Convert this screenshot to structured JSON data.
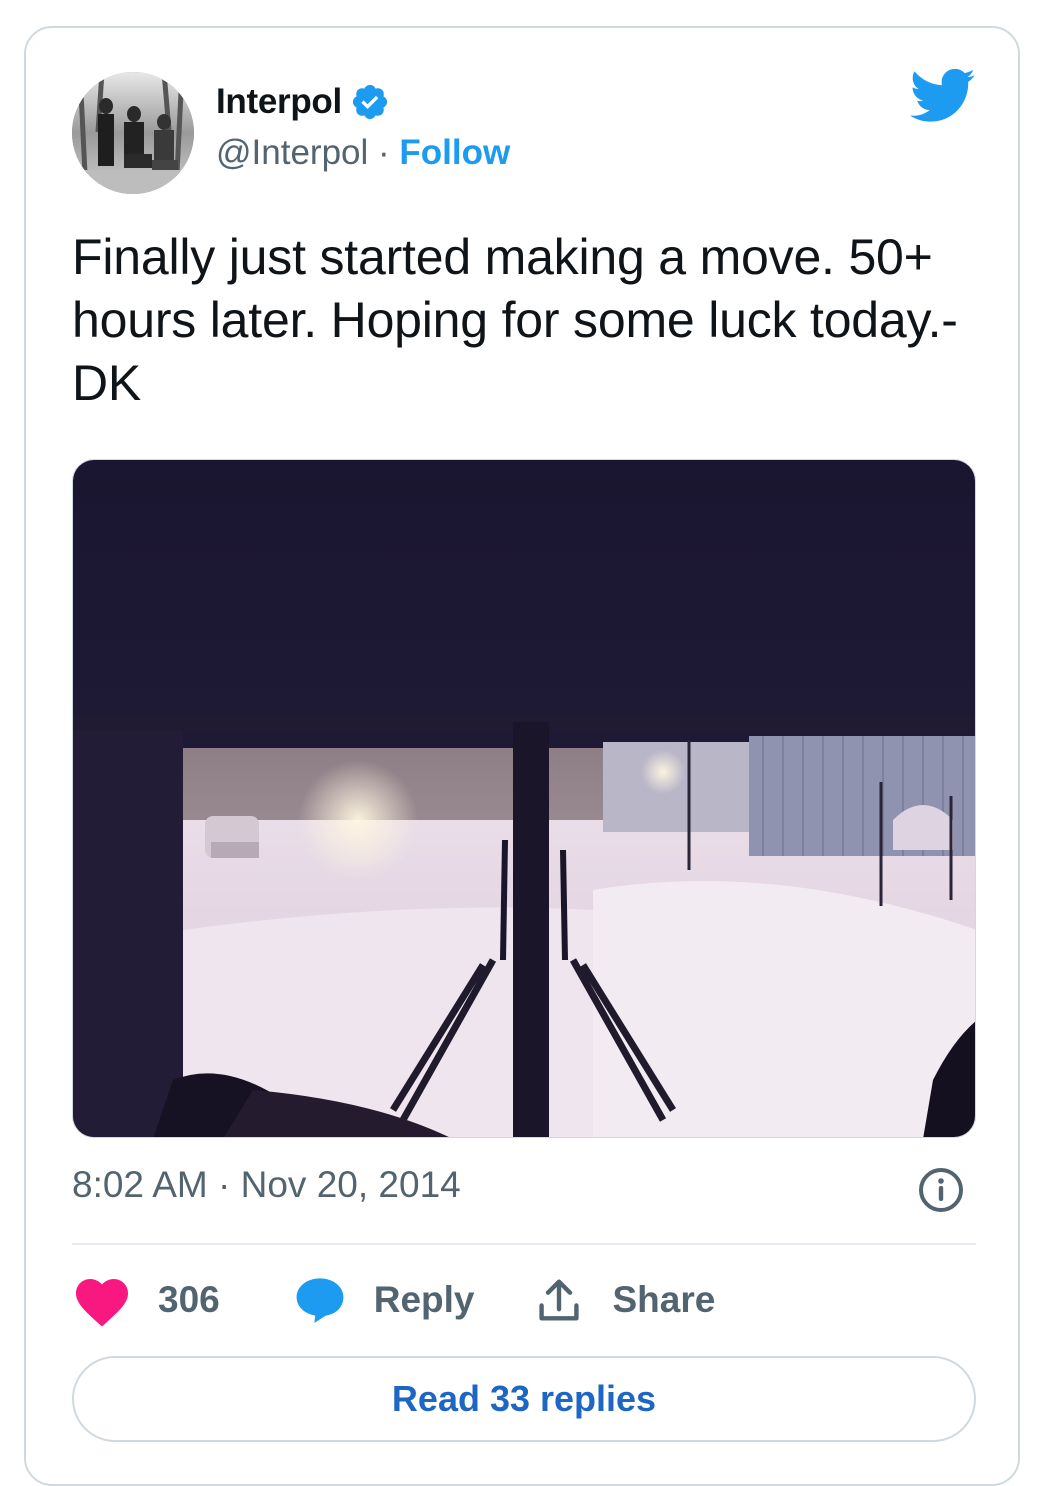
{
  "author": {
    "name": "Interpol",
    "handle": "@Interpol",
    "separator": " · ",
    "follow_label": "Follow",
    "verified": true
  },
  "tweet": {
    "text": "Finally just started making a move. 50+ hours later. Hoping for some luck today.-DK",
    "timestamp": "8:02 AM · Nov 20, 2014"
  },
  "actions": {
    "like_count": "306",
    "reply_label": "Reply",
    "share_label": "Share"
  },
  "read_replies_label": "Read 33 replies",
  "icons": {
    "brand": "twitter-bird-icon",
    "verified": "verified-badge-icon",
    "like": "heart-icon",
    "reply": "speech-bubble-icon",
    "share": "share-upload-icon",
    "info": "info-icon"
  },
  "colors": {
    "accent": "#1d9bf0",
    "like": "#f91880",
    "muted": "#536471",
    "text": "#0f1419",
    "border": "#cfd9de"
  }
}
